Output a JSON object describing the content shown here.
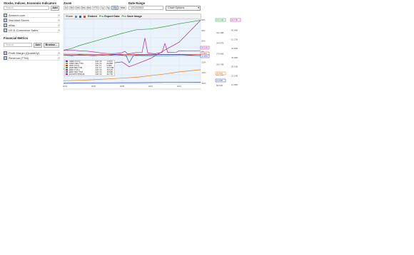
{
  "left": {
    "section_title": "Stocks, Indices, Economic Indicators",
    "search_placeholder": "Search",
    "add_label": "Add",
    "items": [
      {
        "label": "Amazon.com"
      },
      {
        "label": "Wal-Mart Stores"
      },
      {
        "label": "eBay"
      },
      {
        "label": "US E-Commerce Sales"
      }
    ],
    "metrics_title": "Financial Metrics",
    "metrics_search_placeholder": "Search",
    "metrics_add_label": "Add",
    "browse_label": "Browse...",
    "metrics": [
      {
        "label": "Profit Margin (Quarterly)"
      },
      {
        "label": "Revenue (TTM)"
      }
    ]
  },
  "zoom": {
    "label": "Zoom",
    "periods": [
      "1d",
      "5d",
      "1m",
      "3m",
      "6m",
      "YTD",
      "1y",
      "5y",
      "10y",
      "Max"
    ],
    "selected": "10y"
  },
  "date_range": {
    "label": "Date Range",
    "value": "12/12/2003",
    "options_label": "Chart Options"
  },
  "toolbar": {
    "share": "Share",
    "embed": "Embed",
    "pro": "Pro",
    "export": "Export Data",
    "save": "Save Image"
  },
  "chart_data": {
    "type": "line",
    "x": [
      2004,
      2006,
      2008,
      2010,
      2012
    ],
    "x_ticks": [
      "2004",
      "2006",
      "2008",
      "2010",
      "2012"
    ],
    "y_left_ticks": [
      "60%",
      "40%",
      "20%",
      "0%",
      "-20%",
      "-40%",
      "-60%"
    ],
    "y_mid_ticks": [
      "478.9B",
      "412.48B",
      "344.57B",
      "275.66B",
      "206.74B",
      "137.83B",
      "68.91B"
    ],
    "y_right_ticks": [
      "75.48B",
      "65.49B",
      "51.27B",
      "43.59B",
      "36.99B",
      "29.41B",
      "22.14B",
      "14.86B"
    ],
    "badges_right": [
      {
        "label": "472.34B",
        "color": "#2a9d3a"
      },
      {
        "label": "44.77B",
        "color": "#b0259e"
      },
      {
        "label": "25.05B",
        "color": "#e07f1a"
      },
      {
        "label": "13.32B",
        "color": "#2b4fb8"
      }
    ],
    "badges_left": [
      {
        "label": "76.41%",
        "color": "#b0259e"
      },
      {
        "label": "3.48%",
        "color": "#d23a2a"
      },
      {
        "label": "-0.34%",
        "color": "#2b4fb8"
      }
    ],
    "grid": true,
    "legend_position": "bottom-left",
    "legend": [
      {
        "name": "AMZN P M Q",
        "color": "#2b4fb8",
        "date": "JUN '13",
        "value": "-0.31%"
      },
      {
        "name": "AMZN REV TTM",
        "color": "#e07f1a",
        "date": "JUN '13",
        "value": "66.85B"
      },
      {
        "name": "WMT P M Q",
        "color": "#d23a2a",
        "date": "JUL '13",
        "value": "3.48%"
      },
      {
        "name": "WMT REV TTM",
        "color": "#2a9d3a",
        "date": "JUL '13",
        "value": "472.34B"
      },
      {
        "name": "EBAY P M Q",
        "color": "#b0259e",
        "date": "JUN '13",
        "value": "16.51%"
      },
      {
        "name": "EBAY REV TTM",
        "color": "#2b8a9a",
        "date": "JUN '13",
        "value": "15.63B"
      },
      {
        "name": "ECOMTOTPSQ14",
        "color": "#b0259e",
        "date": "JUN '13",
        "value": "44.77B"
      }
    ],
    "series": [
      {
        "name": "WMT REV TTM",
        "color": "#2a9d3a",
        "values": [
          [
            2003.9,
            250
          ],
          [
            2004.5,
            265
          ],
          [
            2005,
            285
          ],
          [
            2006,
            315
          ],
          [
            2007,
            345
          ],
          [
            2008,
            375
          ],
          [
            2009,
            402
          ],
          [
            2010,
            408
          ],
          [
            2011,
            425
          ],
          [
            2012,
            447
          ],
          [
            2013.5,
            472
          ]
        ]
      },
      {
        "name": "ECOMTOTPSQ14",
        "color": "#b0259e",
        "values": [
          [
            2003.9,
            110
          ],
          [
            2004,
            115
          ],
          [
            2005,
            125
          ],
          [
            2006,
            138
          ],
          [
            2007,
            152
          ],
          [
            2008,
            164
          ],
          [
            2008.5,
            128
          ],
          [
            2009,
            148
          ],
          [
            2010,
            190
          ],
          [
            2011,
            252
          ],
          [
            2012,
            310
          ],
          [
            2013.5,
            472
          ]
        ]
      },
      {
        "name": "EBAY P M Q",
        "color": "#b0259e",
        "values": [
          [
            2003.9,
            250
          ],
          [
            2004.5,
            252
          ],
          [
            2005,
            246
          ],
          [
            2005.5,
            244
          ],
          [
            2006,
            238
          ],
          [
            2006.5,
            231
          ],
          [
            2007,
            226
          ],
          [
            2007.5,
            226
          ],
          [
            2008,
            232
          ],
          [
            2008.2,
            242
          ],
          [
            2008.4,
            223
          ],
          [
            2009,
            233
          ],
          [
            2009.4,
            233
          ],
          [
            2009.6,
            340
          ],
          [
            2009.8,
            230
          ],
          [
            2010.3,
            224
          ],
          [
            2010.8,
            234
          ],
          [
            2011,
            300
          ],
          [
            2011.2,
            234
          ],
          [
            2011.8,
            236
          ],
          [
            2012,
            247
          ],
          [
            2012.5,
            244
          ],
          [
            2013.5,
            247
          ]
        ]
      },
      {
        "name": "WMT P M Q",
        "color": "#d23a2a",
        "values": [
          [
            2003.9,
            222
          ],
          [
            2004,
            221
          ],
          [
            2005,
            221
          ],
          [
            2006,
            220
          ],
          [
            2007,
            220
          ],
          [
            2008,
            219
          ],
          [
            2009,
            219
          ],
          [
            2010,
            219
          ],
          [
            2011,
            219
          ],
          [
            2012,
            219
          ],
          [
            2013.5,
            218
          ]
        ]
      },
      {
        "name": "AMZN P M Q",
        "color": "#2b4fb8",
        "values": [
          [
            2003.9,
            214
          ],
          [
            2004.5,
            210
          ],
          [
            2005,
            216
          ],
          [
            2005.6,
            213
          ],
          [
            2006,
            210
          ],
          [
            2006.6,
            214
          ],
          [
            2007,
            212
          ],
          [
            2007.5,
            219
          ],
          [
            2008,
            215
          ],
          [
            2008.3,
            208
          ],
          [
            2008.5,
            158
          ],
          [
            2008.8,
            211
          ],
          [
            2009,
            215
          ],
          [
            2010,
            216
          ],
          [
            2011,
            219
          ],
          [
            2012,
            220
          ],
          [
            2013.5,
            210
          ]
        ]
      },
      {
        "name": "EBAY REV TTM",
        "color": "#2b8a9a",
        "values": [
          [
            2003.9,
            214
          ],
          [
            2005,
            213
          ],
          [
            2006,
            213
          ],
          [
            2007,
            212
          ],
          [
            2008,
            212
          ],
          [
            2009,
            211
          ],
          [
            2010,
            210
          ],
          [
            2011,
            210
          ],
          [
            2012,
            212
          ],
          [
            2013.5,
            211
          ]
        ]
      },
      {
        "name": "AMZN REV TTM",
        "color": "#e07f1a",
        "values": [
          [
            2003.9,
            25
          ],
          [
            2005,
            28
          ],
          [
            2006,
            32
          ],
          [
            2007,
            38
          ],
          [
            2008,
            44
          ],
          [
            2009,
            50
          ],
          [
            2010,
            62
          ],
          [
            2011,
            75
          ],
          [
            2012,
            90
          ],
          [
            2013.5,
            106
          ]
        ]
      },
      {
        "name": "eBay Rev baseline",
        "color": "#2b4fb8",
        "values": [
          [
            2003.9,
            6
          ],
          [
            2005,
            8
          ],
          [
            2006,
            9
          ],
          [
            2007,
            9
          ],
          [
            2008,
            10
          ],
          [
            2009,
            10
          ],
          [
            2010,
            11
          ],
          [
            2011,
            12
          ],
          [
            2012,
            12
          ],
          [
            2013.5,
            13
          ]
        ]
      }
    ]
  }
}
